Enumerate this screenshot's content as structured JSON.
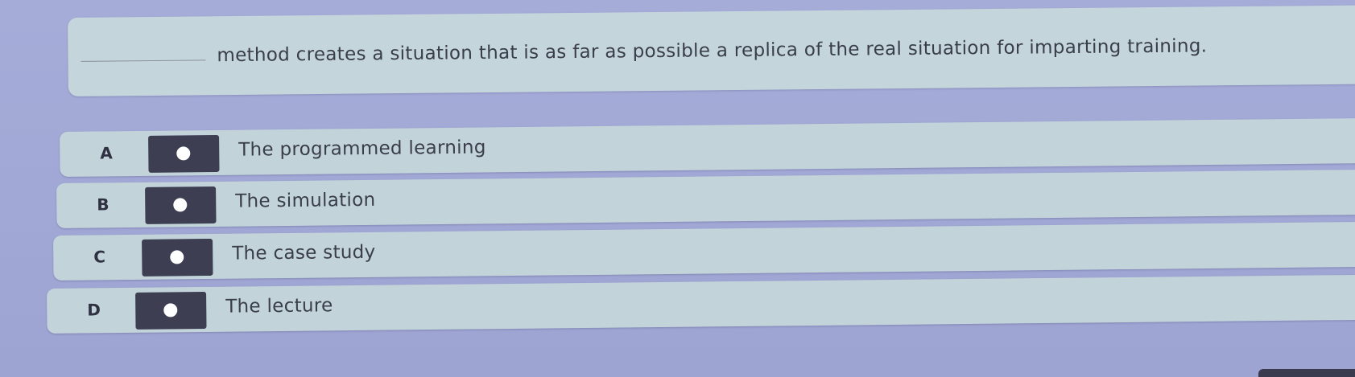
{
  "question": {
    "text": "method creates a situation that is as far as possible a replica of the real situation for imparting training."
  },
  "options": [
    {
      "letter": "A",
      "label": "The programmed learning"
    },
    {
      "letter": "B",
      "label": "The simulation"
    },
    {
      "letter": "C",
      "label": "The case study"
    },
    {
      "letter": "D",
      "label": "The lecture"
    }
  ],
  "colors": {
    "background": "#a4aad6",
    "card": "#c3d5db",
    "button": "#3d3e52",
    "text": "#3a3d4a"
  },
  "icons": {
    "option_button": "radio-dot-icon"
  }
}
